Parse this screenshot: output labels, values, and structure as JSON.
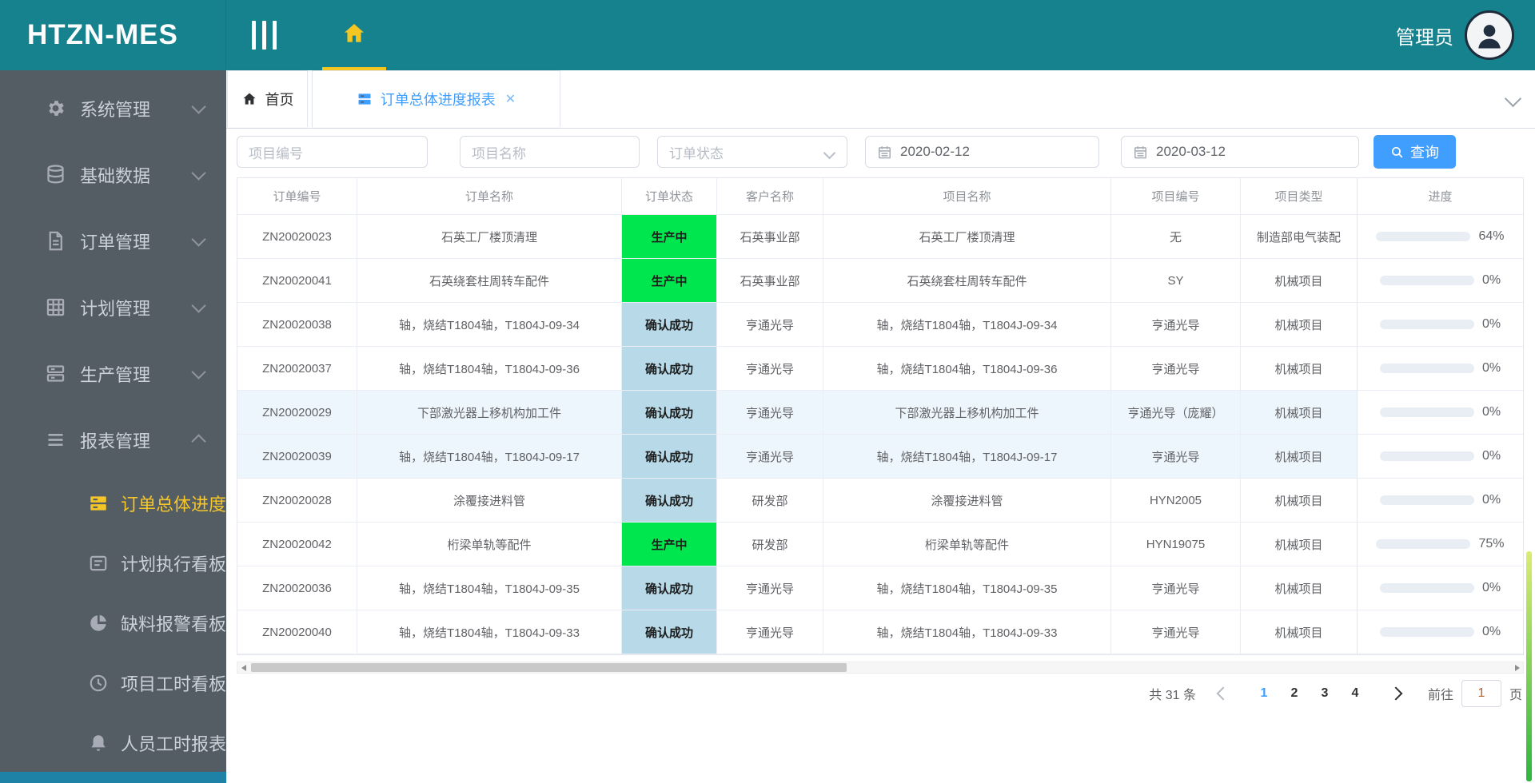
{
  "colors": {
    "header_teal": "#15828d",
    "accent_blue": "#409eff",
    "active_gold": "#f3c622",
    "status_green": "#00e64f",
    "status_light_blue": "#b7d9e8"
  },
  "header": {
    "logo": "HTZN-MES",
    "user": "管理员"
  },
  "sidebar": {
    "items": [
      {
        "label": "系统管理",
        "icon": "gear-icon",
        "expanded": false
      },
      {
        "label": "基础数据",
        "icon": "database-icon",
        "expanded": false
      },
      {
        "label": "订单管理",
        "icon": "document-icon",
        "expanded": false
      },
      {
        "label": "计划管理",
        "icon": "grid-icon",
        "expanded": false
      },
      {
        "label": "生产管理",
        "icon": "production-icon",
        "expanded": false
      },
      {
        "label": "报表管理",
        "icon": "list-icon",
        "expanded": true
      }
    ],
    "subitems": [
      {
        "label": "订单总体进度报表",
        "icon": "report-icon",
        "active": true
      },
      {
        "label": "计划执行看板",
        "icon": "board-icon",
        "active": false
      },
      {
        "label": "缺料报警看板",
        "icon": "pie-icon",
        "active": false
      },
      {
        "label": "项目工时看板",
        "icon": "clock-icon",
        "active": false
      },
      {
        "label": "人员工时报表",
        "icon": "bell-icon",
        "active": false
      }
    ]
  },
  "tabs": [
    {
      "label": "首页",
      "icon": "home-icon",
      "active": false,
      "closable": false
    },
    {
      "label": "订单总体进度报表",
      "icon": "report-icon",
      "active": true,
      "closable": true,
      "close_glyph": "✕"
    }
  ],
  "filters": {
    "project_no_placeholder": "项目编号",
    "project_name_placeholder": "项目名称",
    "order_status_placeholder": "订单状态",
    "date_from": "2020-02-12",
    "date_to": "2020-03-12",
    "search_label": "查询"
  },
  "table": {
    "columns": [
      "订单编号",
      "订单名称",
      "订单状态",
      "客户名称",
      "项目名称",
      "项目编号",
      "项目类型",
      "进度"
    ],
    "rows": [
      {
        "order_no": "ZN20020023",
        "order_name": "石英工厂楼顶清理",
        "status": "生产中",
        "status_color": "green",
        "customer": "石英事业部",
        "project_name": "石英工厂楼顶清理",
        "project_no": "无",
        "project_type": "制造部电气装配",
        "progress": 64,
        "tinted": false
      },
      {
        "order_no": "ZN20020041",
        "order_name": "石英绕套柱周转车配件",
        "status": "生产中",
        "status_color": "green",
        "customer": "石英事业部",
        "project_name": "石英绕套柱周转车配件",
        "project_no": "SY",
        "project_type": "机械项目",
        "progress": 0,
        "tinted": false
      },
      {
        "order_no": "ZN20020038",
        "order_name": "轴，烧结T1804轴，T1804J-09-34",
        "status": "确认成功",
        "status_color": "blue",
        "customer": "亨通光导",
        "project_name": "轴，烧结T1804轴，T1804J-09-34",
        "project_no": "亨通光导",
        "project_type": "机械项目",
        "progress": 0,
        "tinted": false
      },
      {
        "order_no": "ZN20020037",
        "order_name": "轴，烧结T1804轴，T1804J-09-36",
        "status": "确认成功",
        "status_color": "blue",
        "customer": "亨通光导",
        "project_name": "轴，烧结T1804轴，T1804J-09-36",
        "project_no": "亨通光导",
        "project_type": "机械项目",
        "progress": 0,
        "tinted": false
      },
      {
        "order_no": "ZN20020029",
        "order_name": "下部激光器上移机构加工件",
        "status": "确认成功",
        "status_color": "blue",
        "customer": "亨通光导",
        "project_name": "下部激光器上移机构加工件",
        "project_no": "亨通光导（庞耀）",
        "project_type": "机械项目",
        "progress": 0,
        "tinted": true
      },
      {
        "order_no": "ZN20020039",
        "order_name": "轴，烧结T1804轴，T1804J-09-17",
        "status": "确认成功",
        "status_color": "blue",
        "customer": "亨通光导",
        "project_name": "轴，烧结T1804轴，T1804J-09-17",
        "project_no": "亨通光导",
        "project_type": "机械项目",
        "progress": 0,
        "tinted": true
      },
      {
        "order_no": "ZN20020028",
        "order_name": "涂覆接进料管",
        "status": "确认成功",
        "status_color": "blue",
        "customer": "研发部",
        "project_name": "涂覆接进料管",
        "project_no": "HYN2005",
        "project_type": "机械项目",
        "progress": 0,
        "tinted": false
      },
      {
        "order_no": "ZN20020042",
        "order_name": "桁梁单轨等配件",
        "status": "生产中",
        "status_color": "green",
        "customer": "研发部",
        "project_name": "桁梁单轨等配件",
        "project_no": "HYN19075",
        "project_type": "机械项目",
        "progress": 75,
        "tinted": false
      },
      {
        "order_no": "ZN20020036",
        "order_name": "轴，烧结T1804轴，T1804J-09-35",
        "status": "确认成功",
        "status_color": "blue",
        "customer": "亨通光导",
        "project_name": "轴，烧结T1804轴，T1804J-09-35",
        "project_no": "亨通光导",
        "project_type": "机械项目",
        "progress": 0,
        "tinted": false
      },
      {
        "order_no": "ZN20020040",
        "order_name": "轴，烧结T1804轴，T1804J-09-33",
        "status": "确认成功",
        "status_color": "blue",
        "customer": "亨通光导",
        "project_name": "轴，烧结T1804轴，T1804J-09-33",
        "project_no": "亨通光导",
        "project_type": "机械项目",
        "progress": 0,
        "tinted": false
      }
    ]
  },
  "pagination": {
    "total": "共 31 条",
    "pages": [
      "1",
      "2",
      "3",
      "4"
    ],
    "current": "1",
    "goto_label": "前往",
    "goto_value": "1",
    "page_unit": "页"
  }
}
